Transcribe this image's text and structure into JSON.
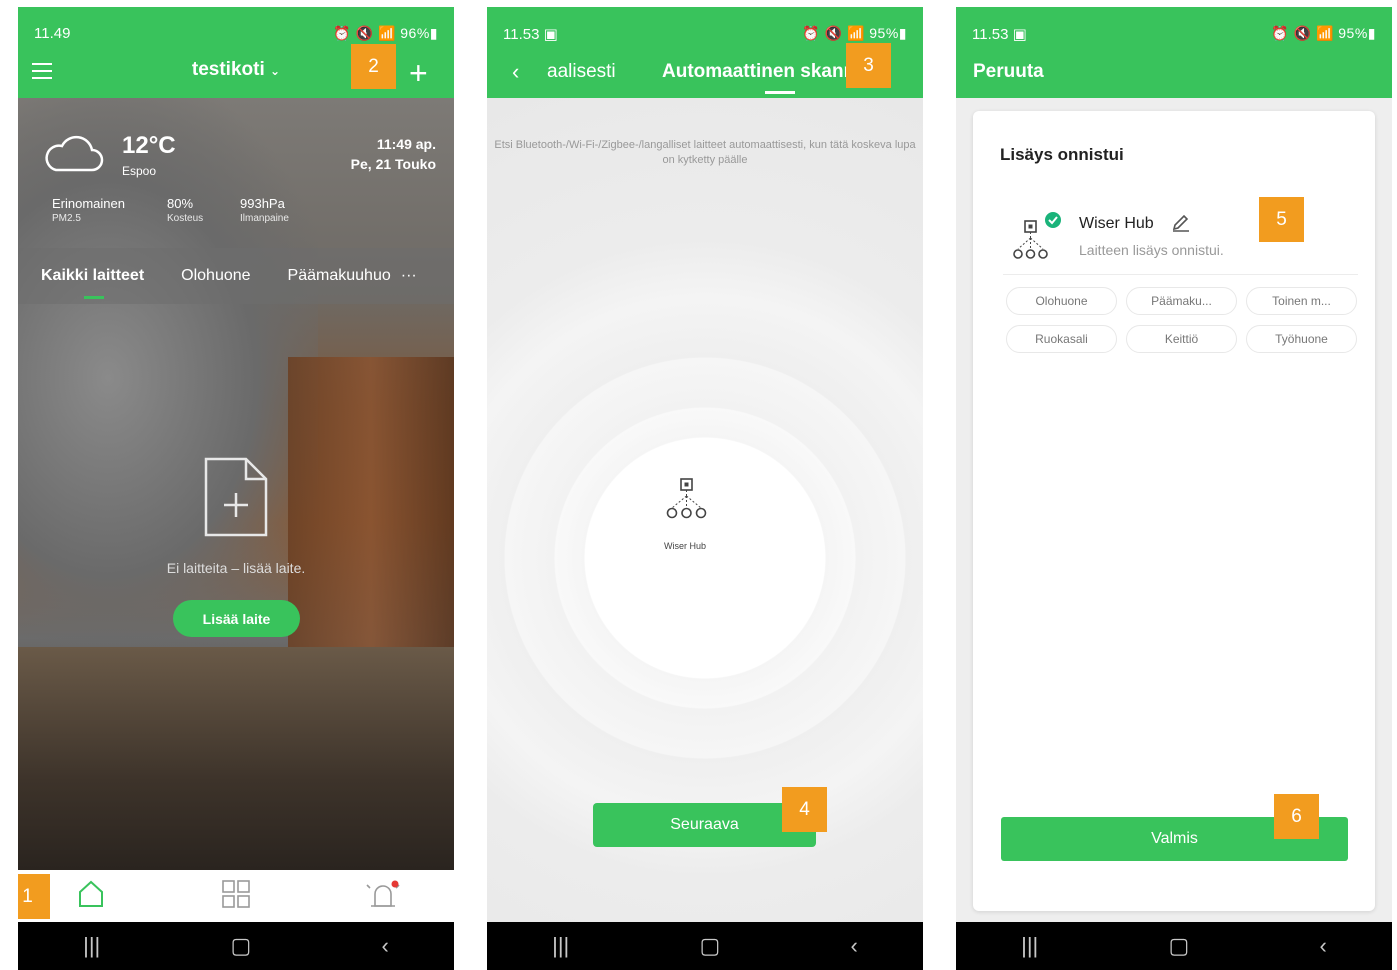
{
  "screens": [
    {
      "status_time": "11.49",
      "status_right": "⏰ 🔇 📶 96%▮",
      "title": "testikoti",
      "weather": {
        "temp": "12°C",
        "city": "Espoo",
        "time": "11:49 ap.",
        "date": "Pe, 21 Touko",
        "stats": [
          {
            "value": "Erinomainen",
            "label": "PM2.5"
          },
          {
            "value": "80%",
            "label": "Kosteus"
          },
          {
            "value": "993hPa",
            "label": "Ilmanpaine"
          }
        ]
      },
      "room_tabs": [
        "Kaikki laitteet",
        "Olohuone",
        "Päämakuuhuo",
        "···"
      ],
      "empty_text": "Ei laitteita – lisää laite.",
      "add_button": "Lisää laite",
      "badges": [
        "1",
        "2"
      ]
    },
    {
      "status_time": "11.53 ▣",
      "status_right": "⏰ 🔇 📶 95%▮",
      "tab_left": "aalisesti",
      "tab_right": "Automaattinen skannaus",
      "hint": "Etsi Bluetooth-/Wi-Fi-/Zigbee-/langalliset laitteet automaattisesti, kun tätä koskeva lupa on kytketty päälle",
      "hub_label": "Wiser Hub",
      "next_button": "Seuraava",
      "badges": [
        "3",
        "4"
      ]
    },
    {
      "status_time": "11.53 ▣",
      "status_right": "⏰ 🔇 📶 95%▮",
      "cancel": "Peruuta",
      "card_title": "Lisäys onnistui",
      "device_name": "Wiser Hub",
      "device_status": "Laitteen lisäys onnistui.",
      "rooms": [
        "Olohuone",
        "Päämaku...",
        "Toinen m...",
        "Ruokasali",
        "Keittiö",
        "Työhuone"
      ],
      "done_button": "Valmis",
      "badges": [
        "5",
        "6"
      ]
    }
  ],
  "colors": {
    "brand_green": "#39c35c",
    "badge_orange": "#f29c1f"
  },
  "icons": [
    "menu-icon",
    "plus-icon",
    "cloud-icon",
    "add-document-icon",
    "home-icon",
    "grid-icon",
    "alarm-icon",
    "back-icon",
    "hub-icon",
    "check-icon",
    "edit-icon"
  ]
}
